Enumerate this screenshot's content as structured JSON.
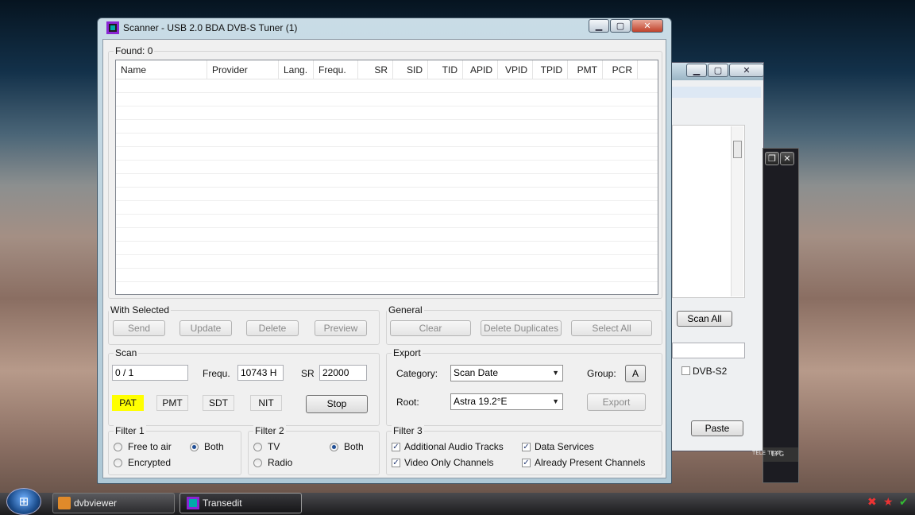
{
  "window": {
    "title": "Scanner - USB 2.0 BDA DVB-S Tuner (1)"
  },
  "found": {
    "label": "Found:",
    "value": "0"
  },
  "list": {
    "columns": [
      "Name",
      "Provider",
      "Lang.",
      "Frequ.",
      "SR",
      "SID",
      "TID",
      "APID",
      "VPID",
      "TPID",
      "PMT",
      "PCR"
    ]
  },
  "with_selected": {
    "label": "With Selected",
    "buttons": [
      "Send",
      "Update",
      "Delete",
      "Preview"
    ]
  },
  "general": {
    "label": "General",
    "buttons": [
      "Clear",
      "Delete Duplicates",
      "Select All"
    ]
  },
  "scan": {
    "label": "Scan",
    "progress": "0 / 1",
    "frequ_label": "Frequ.",
    "frequ_value": "10743 H",
    "sr_label": "SR",
    "sr_value": "22000",
    "tables": [
      "PAT",
      "PMT",
      "SDT",
      "NIT"
    ],
    "stop_label": "Stop",
    "highlight_color": "#ffff00"
  },
  "export": {
    "label": "Export",
    "category_label": "Category:",
    "category_value": "Scan Date",
    "group_label": "Group:",
    "group_value": "A",
    "root_label": "Root:",
    "root_value": "Astra 19.2°E",
    "export_label": "Export"
  },
  "filter1": {
    "label": "Filter 1",
    "free": "Free to air",
    "both": "Both",
    "encrypted": "Encrypted"
  },
  "filter2": {
    "label": "Filter 2",
    "tv": "TV",
    "both": "Both",
    "radio": "Radio"
  },
  "filter3": {
    "label": "Filter 3",
    "audio": "Additional Audio Tracks",
    "video": "Video Only Channels",
    "data": "Data Services",
    "present": "Already Present Channels"
  },
  "background_window": {
    "scan_all": "Scan All",
    "dvbs2": "DVB-S2",
    "paste": "Paste"
  },
  "player": {
    "tele": "TELE TEXT",
    "epg": "EPG"
  },
  "taskbar": {
    "items": [
      "dvbviewer",
      "Transedit"
    ]
  }
}
